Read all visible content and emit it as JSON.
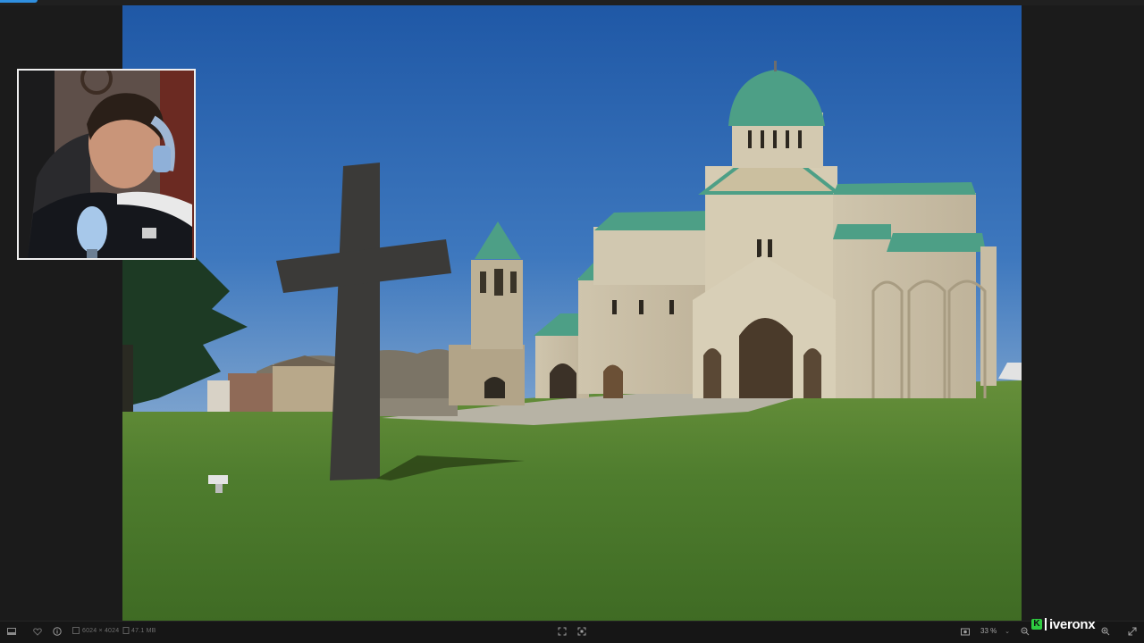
{
  "statusbar": {
    "dimensions": "6024 × 4024",
    "filesize": "47.1 MB",
    "zoom": "33 %"
  },
  "brand": {
    "mark": "K",
    "name": "iveronx"
  },
  "icons": {
    "panel": "panel-toggle-icon",
    "favorite": "heart-icon",
    "info": "info-icon",
    "fit": "fit-screen-icon",
    "actual": "actual-size-icon",
    "screenshot": "camera-icon",
    "zoom_out": "zoom-out-icon",
    "zoom_in": "zoom-in-icon",
    "fullscreen": "fullscreen-icon"
  },
  "colors": {
    "accent": "#2f8fe0",
    "brand_green": "#2ecc40",
    "sky": "#2d62ad",
    "grass": "#4f7d2e",
    "roof": "#4d9f86"
  }
}
